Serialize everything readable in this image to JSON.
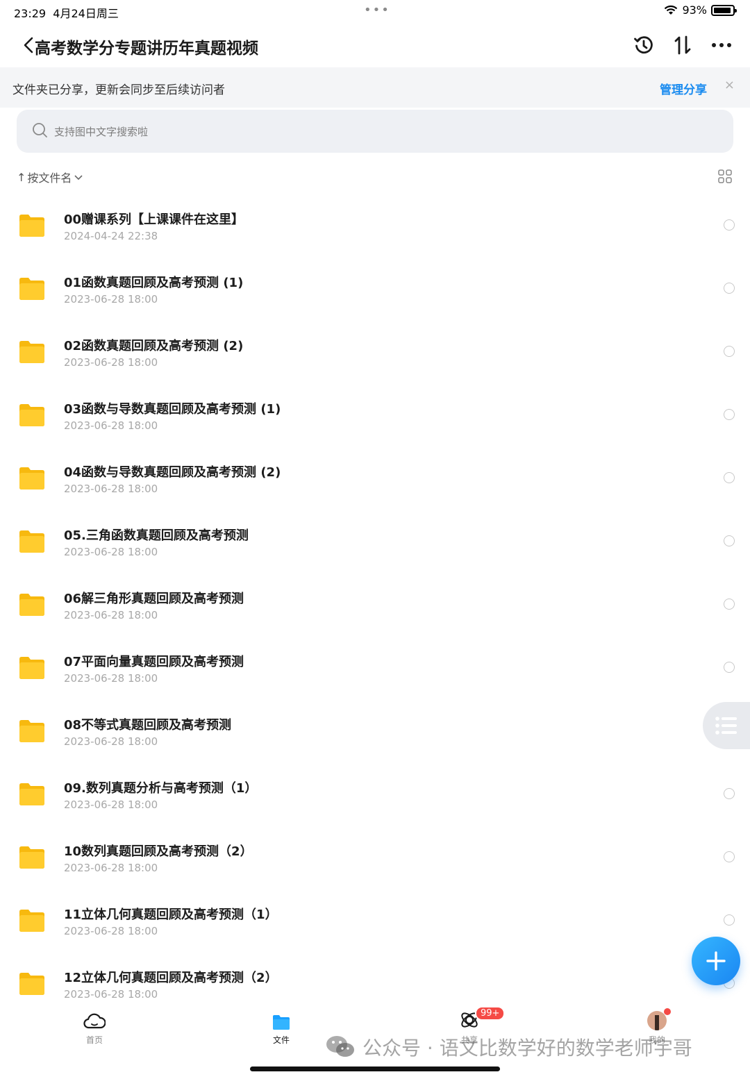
{
  "status_bar": {
    "time": "23:29",
    "date": "4月24日周三",
    "dots": "•••",
    "battery_text": "93%",
    "battery_level": 0.93
  },
  "header": {
    "title": "高考数学分专题讲历年真题视频",
    "actions": [
      "history-icon",
      "sort-transfer-icon",
      "more-icon"
    ]
  },
  "share_banner": {
    "text": "文件夹已分享，更新会同步至后续访问者",
    "action_label": "管理分享",
    "close_label": "×"
  },
  "search": {
    "placeholder": "支持图中文字搜索啦"
  },
  "sort": {
    "label": "按文件名",
    "arrow": "↑"
  },
  "files": [
    {
      "name": "00赠课系列【上课课件在这里】",
      "date": "2024-04-24 22:38"
    },
    {
      "name": "01函数真题回顾及高考预测 (1)",
      "date": "2023-06-28 18:00"
    },
    {
      "name": "02函数真题回顾及高考预测 (2)",
      "date": "2023-06-28 18:00"
    },
    {
      "name": "03函数与导数真题回顾及高考预测 (1)",
      "date": "2023-06-28 18:00"
    },
    {
      "name": "04函数与导数真题回顾及高考预测 (2)",
      "date": "2023-06-28 18:00"
    },
    {
      "name": "05.三角函数真题回顾及高考预测",
      "date": "2023-06-28 18:00"
    },
    {
      "name": "06解三角形真题回顾及高考预测",
      "date": "2023-06-28 18:00"
    },
    {
      "name": "07平面向量真题回顾及高考预测",
      "date": "2023-06-28 18:00"
    },
    {
      "name": "08不等式真题回顾及高考预测",
      "date": "2023-06-28 18:00"
    },
    {
      "name": "09.数列真题分析与高考预测（1）",
      "date": "2023-06-28 18:00"
    },
    {
      "name": "10数列真题回顾及高考预测（2）",
      "date": "2023-06-28 18:00"
    },
    {
      "name": "11立体几何真题回顾及高考预测（1）",
      "date": "2023-06-28 18:00"
    },
    {
      "name": "12立体几何真题回顾及高考预测（2）",
      "date": "2023-06-28 18:00"
    }
  ],
  "tabs": [
    {
      "label": "首页",
      "icon": "cloud-home-icon"
    },
    {
      "label": "文件",
      "icon": "folder-tab-icon",
      "active": true
    },
    {
      "label": "共享",
      "icon": "share-orbit-icon",
      "badge": "99+"
    },
    {
      "label": "我的",
      "icon": "avatar"
    }
  ],
  "watermark": {
    "text": "公众号 · 语文比数学好的数学老师宇哥"
  },
  "colors": {
    "accent": "#1b8cf0",
    "folder": "#ffc928",
    "badge": "#f54a45"
  }
}
